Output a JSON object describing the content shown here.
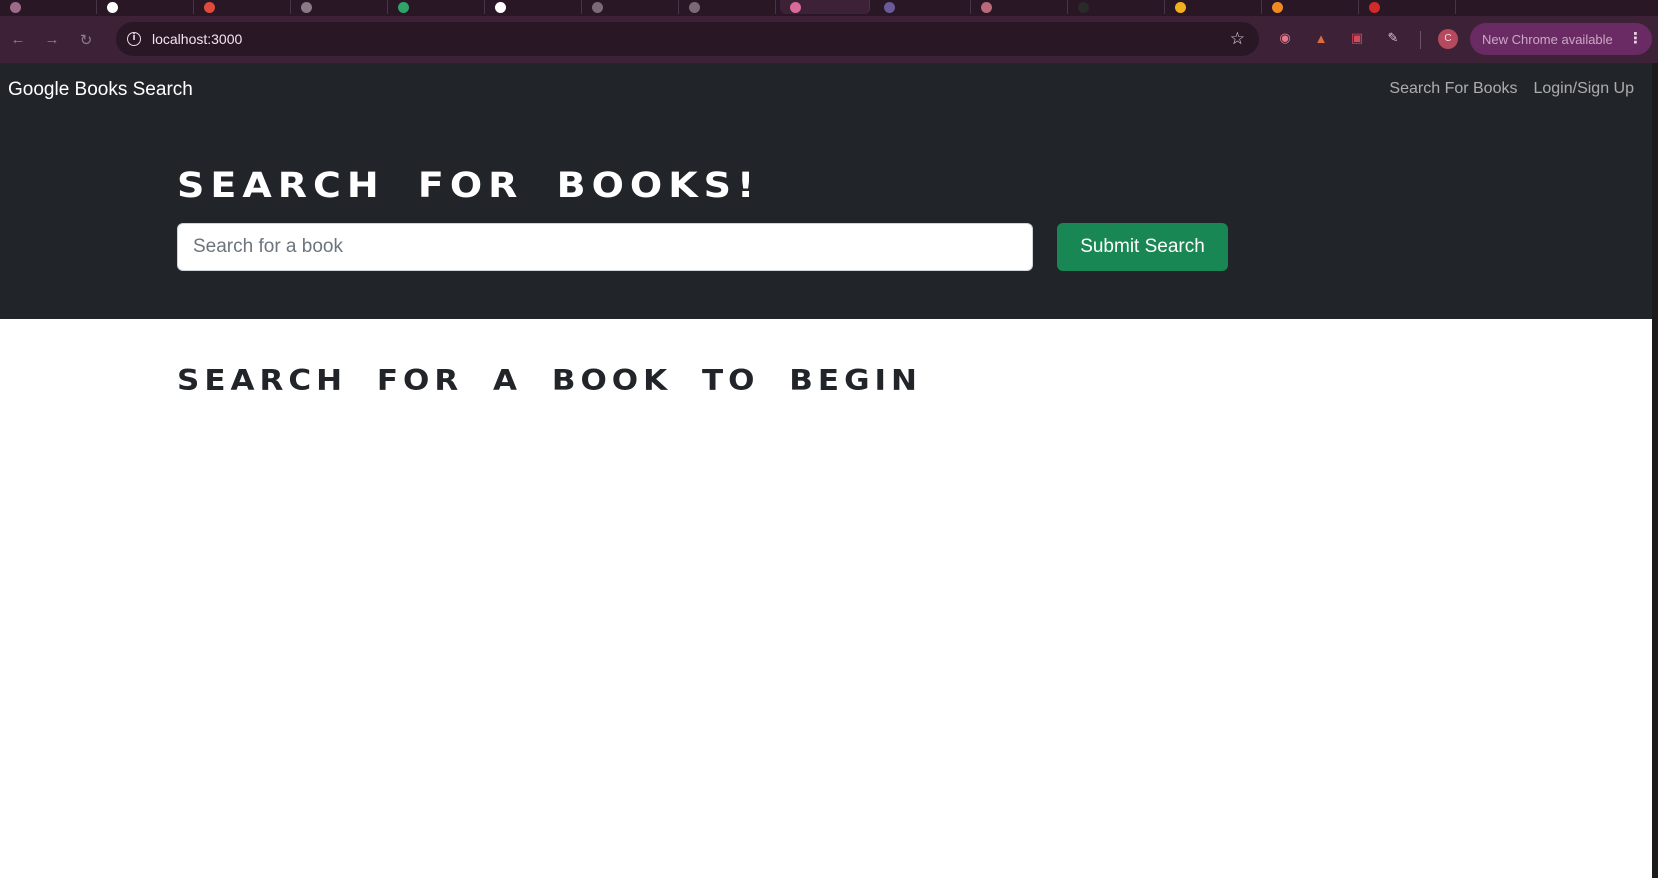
{
  "browser": {
    "tabs": [
      {
        "favicon_color": "#9b6b8c"
      },
      {
        "favicon_color": "#ffffff"
      },
      {
        "favicon_color": "#e04a3a"
      },
      {
        "favicon_color": "#8a7a88"
      },
      {
        "favicon_color": "#2ea46a"
      },
      {
        "favicon_color": "#ffffff"
      },
      {
        "favicon_color": "#7a6a78"
      },
      {
        "favicon_color": "#7a6a78"
      },
      {
        "favicon_color": "#d96a9a",
        "active": true
      },
      {
        "favicon_color": "#6a5a9a"
      },
      {
        "favicon_color": "#b86a7a"
      },
      {
        "favicon_color": "#2a2a2a"
      },
      {
        "favicon_color": "#f0b020"
      },
      {
        "favicon_color": "#f08a20"
      },
      {
        "favicon_color": "#d02a2a"
      }
    ],
    "back_icon": "back-arrow-icon",
    "forward_icon": "forward-arrow-icon",
    "reload_icon": "reload-icon",
    "url": "localhost:3000",
    "update_label": "New Chrome available",
    "profile_initial": "C",
    "colors": {
      "frame": "#3d2237",
      "omnibox": "#2a1726",
      "update_chip": "#6a2a63"
    }
  },
  "navbar": {
    "brand": "Google Books Search",
    "links": [
      "Search For Books",
      "Login/Sign Up"
    ]
  },
  "hero": {
    "title": "Search for Books!",
    "search_placeholder": "Search for a book",
    "search_value": "",
    "submit_label": "Submit Search"
  },
  "results": {
    "heading": "Search for a book to begin"
  },
  "colors": {
    "dark": "#212529",
    "success": "#198754",
    "white": "#ffffff"
  }
}
